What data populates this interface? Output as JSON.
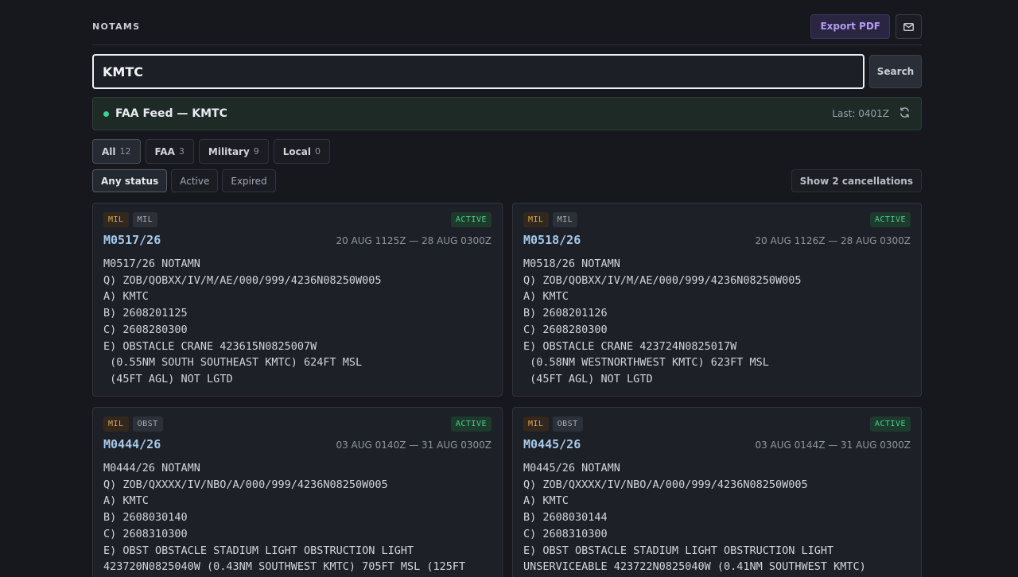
{
  "header": {
    "title": "NOTAMS",
    "export_label": "Export PDF",
    "mail_icon": "mail-icon"
  },
  "search": {
    "value": "KMTC",
    "button_label": "Search"
  },
  "feed": {
    "title": "FAA Feed — KMTC",
    "last": "Last: 0401Z",
    "status_color": "#3fcf8e"
  },
  "source_filters": [
    {
      "label": "All",
      "count": "12",
      "selected": true
    },
    {
      "label": "FAA",
      "count": "3",
      "selected": false
    },
    {
      "label": "Military",
      "count": "9",
      "selected": false
    },
    {
      "label": "Local",
      "count": "0",
      "selected": false
    }
  ],
  "status_filters": [
    {
      "label": "Any status",
      "selected": true
    },
    {
      "label": "Active",
      "selected": false
    },
    {
      "label": "Expired",
      "selected": false
    }
  ],
  "cancellations_label": "Show 2 cancellations",
  "notams": [
    {
      "tags": [
        "MIL",
        "MIL"
      ],
      "status": "ACTIVE",
      "id": "M0517/26",
      "period": "20 AUG 1125Z — 28 AUG 0300Z",
      "text": "M0517/26 NOTAMN\nQ) ZOB/QOBXX/IV/M/AE/000/999/4236N08250W005\nA) KMTC\nB) 2608201125\nC) 2608280300\nE) OBSTACLE CRANE 423615N0825007W\n (0.55NM SOUTH SOUTHEAST KMTC) 624FT MSL\n (45FT AGL) NOT LGTD"
    },
    {
      "tags": [
        "MIL",
        "MIL"
      ],
      "status": "ACTIVE",
      "id": "M0518/26",
      "period": "20 AUG 1126Z — 28 AUG 0300Z",
      "text": "M0518/26 NOTAMN\nQ) ZOB/QOBXX/IV/M/AE/000/999/4236N08250W005\nA) KMTC\nB) 2608201126\nC) 2608280300\nE) OBSTACLE CRANE 423724N0825017W\n (0.58NM WESTNORTHWEST KMTC) 623FT MSL\n (45FT AGL) NOT LGTD"
    },
    {
      "tags": [
        "MIL",
        "OBST"
      ],
      "status": "ACTIVE",
      "id": "M0444/26",
      "period": "03 AUG 0140Z — 31 AUG 0300Z",
      "text": "M0444/26 NOTAMN\nQ) ZOB/QXXXX/IV/NBO/A/000/999/4236N08250W005\nA) KMTC\nB) 2608030140\nC) 2608310300\nE) OBST OBSTACLE STADIUM LIGHT OBSTRUCTION LIGHT\n423720N0825040W (0.43NM SOUTHWEST KMTC) 705FT MSL (125FT"
    },
    {
      "tags": [
        "MIL",
        "OBST"
      ],
      "status": "ACTIVE",
      "id": "M0445/26",
      "period": "03 AUG 0144Z — 31 AUG 0300Z",
      "text": "M0445/26 NOTAMN\nQ) ZOB/QXXXX/IV/NBO/A/000/999/4236N08250W005\nA) KMTC\nB) 2608030144\nC) 2608310300\nE) OBST OBSTACLE STADIUM LIGHT OBSTRUCTION LIGHT\nUNSERVICEABLE 423722N0825040W (0.41NM SOUTHWEST KMTC)"
    }
  ]
}
